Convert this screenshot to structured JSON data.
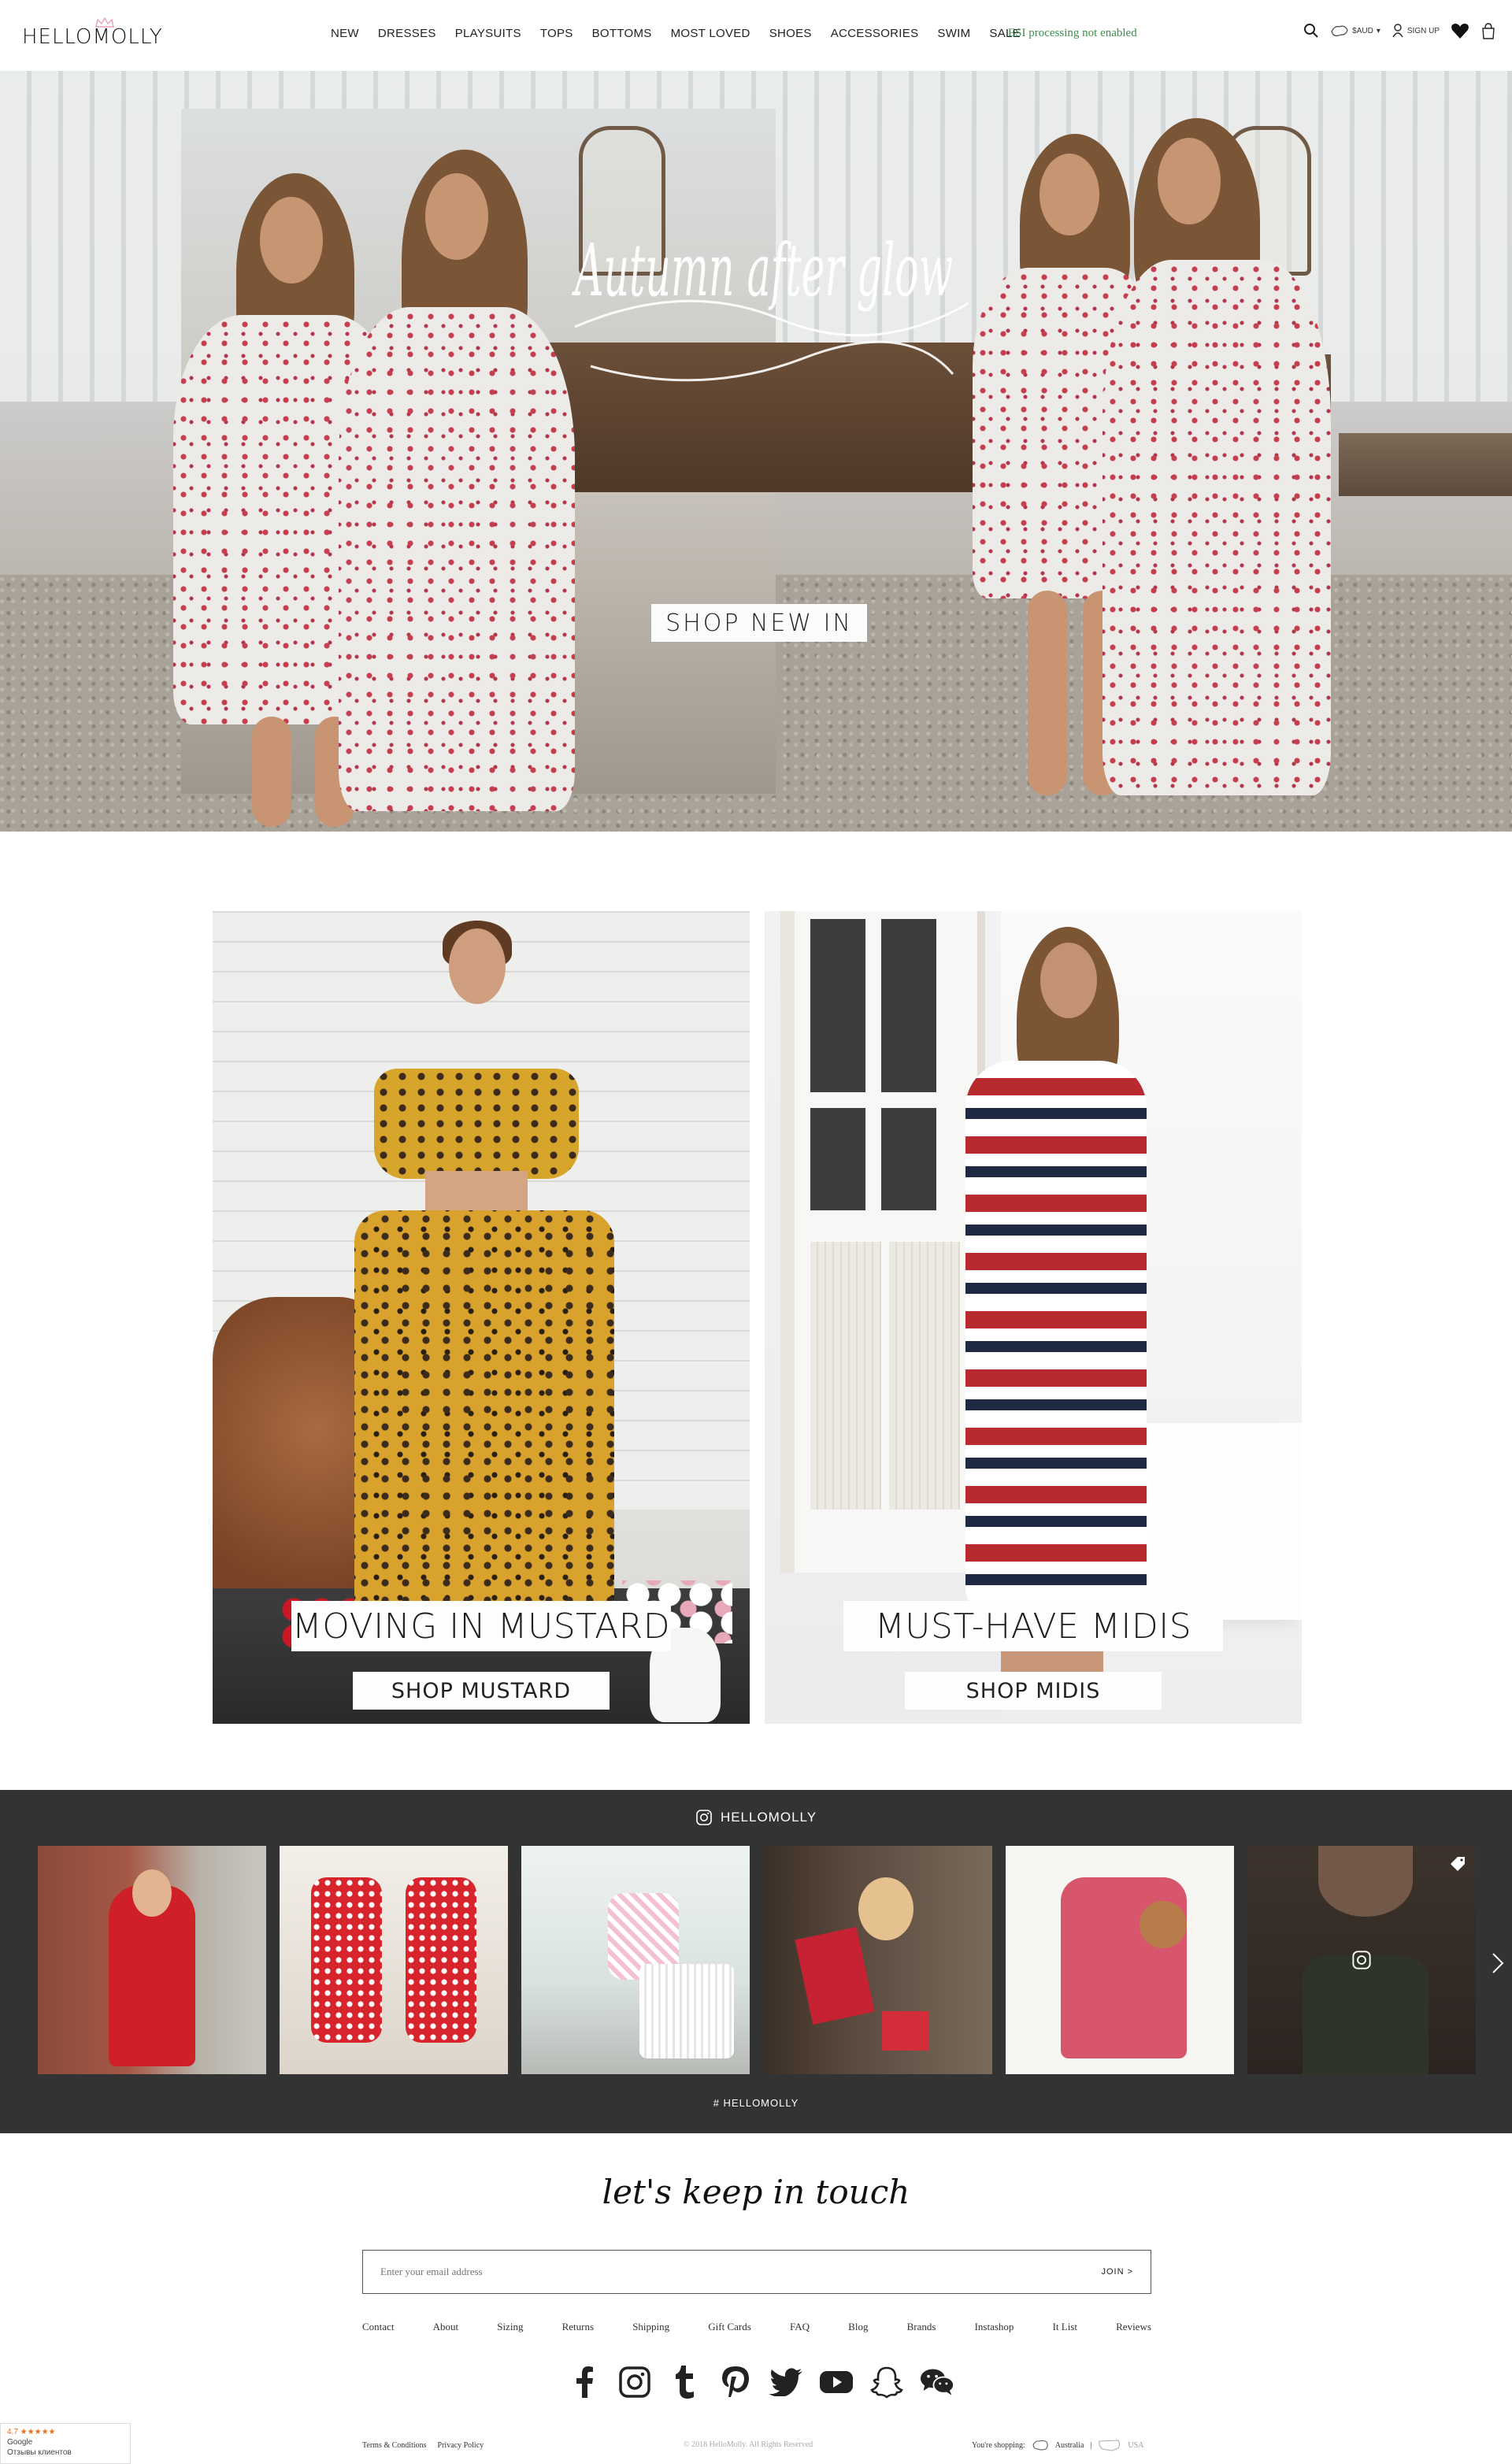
{
  "header": {
    "logo_text": "HELLOMOLLY",
    "nav": [
      "NEW",
      "DRESSES",
      "PLAYSUITS",
      "TOPS",
      "BOTTOMS",
      "MOST LOVED",
      "SHOES",
      "ACCESSORIES",
      "SWIM",
      "SALE"
    ],
    "esi_note": "ESI processing not enabled",
    "currency": "$AUD",
    "signup": "SIGN UP"
  },
  "hero": {
    "script_title": "Autumn after glow",
    "cta": "SHOP NEW IN"
  },
  "promos": [
    {
      "title": "MOVING IN MUSTARD",
      "button": "SHOP MUSTARD"
    },
    {
      "title": "MUST-HAVE MIDIS",
      "button": "SHOP MIDIS"
    }
  ],
  "instagram": {
    "handle": "HELLOMOLLY",
    "hashtag": "# HELLOMOLLY"
  },
  "footer": {
    "heading": "let's keep in touch",
    "email_placeholder": "Enter your email address",
    "join": "JOIN >",
    "links": [
      "Contact",
      "About",
      "Sizing",
      "Returns",
      "Shipping",
      "Gift Cards",
      "FAQ",
      "Blog",
      "Brands",
      "Instashop",
      "It List",
      "Reviews"
    ],
    "socials": [
      "facebook-icon",
      "instagram-icon",
      "tumblr-icon",
      "pinterest-icon",
      "twitter-icon",
      "youtube-icon",
      "snapchat-icon",
      "wechat-icon"
    ],
    "legal": [
      "Terms & Conditions",
      "Privacy Policy"
    ],
    "copyright": "© 2018 HelloMolly. All Rights Reserved",
    "shipping_label": "You're shopping:",
    "shipping_current": "Australia",
    "shipping_other": "USA"
  },
  "google_badge": {
    "rating": "4.7 ★★★★★",
    "brand": "Google",
    "caption": "Отзывы клиентов"
  },
  "colors": {
    "esi_green": "#3b8f4d",
    "insta_bg": "#333333",
    "accent_pink": "#e8a0b4"
  }
}
